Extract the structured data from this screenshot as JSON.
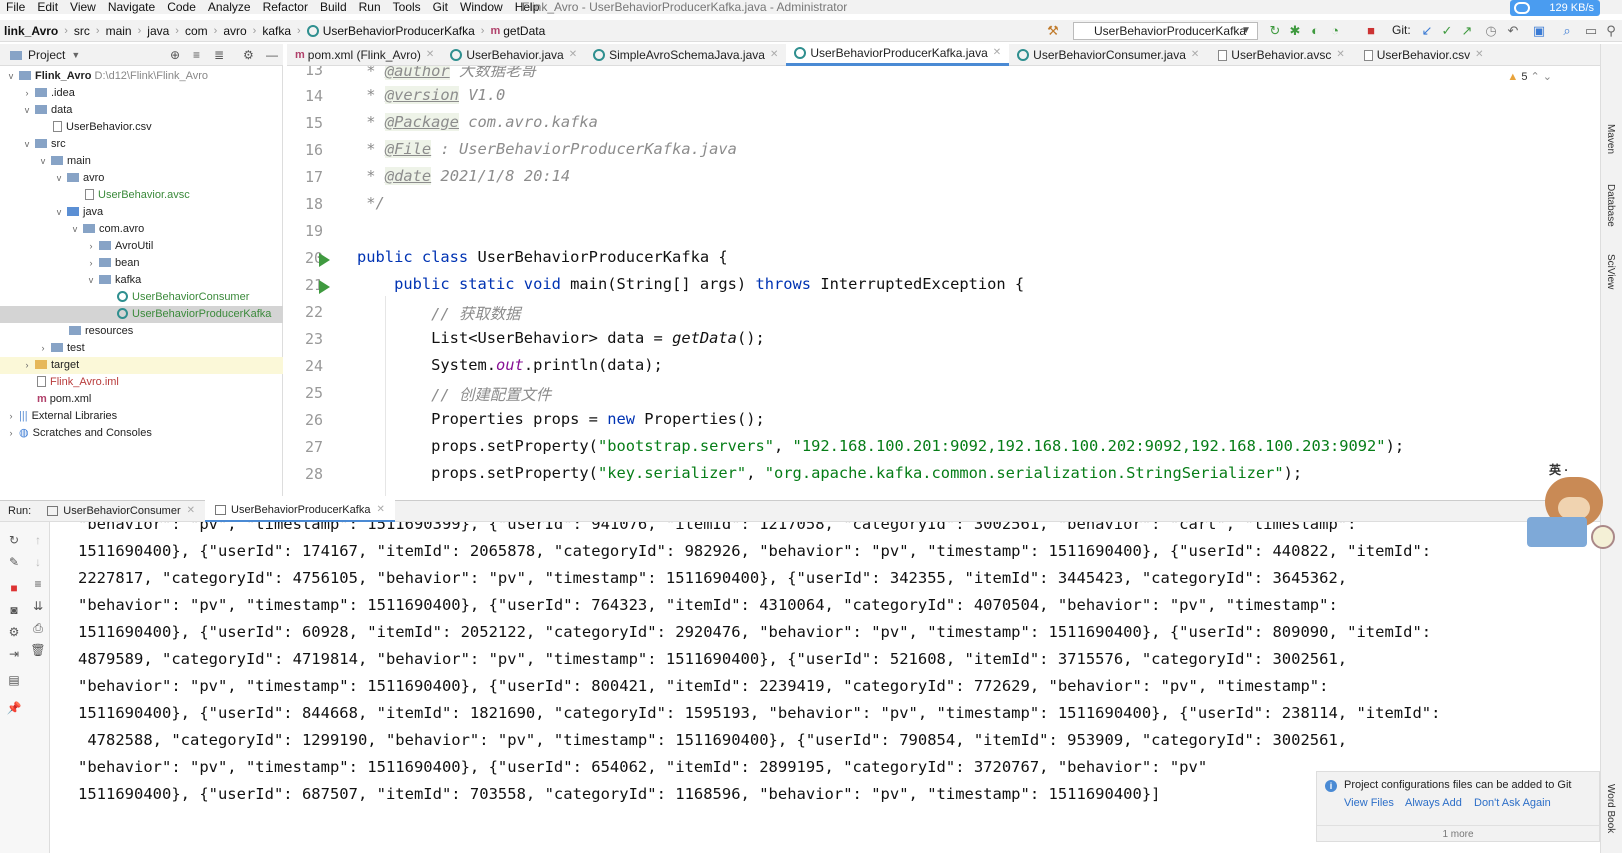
{
  "window": {
    "title": "Flink_Avro - UserBehaviorProducerKafka.java - Administrator",
    "net_speed": "129 KB/s"
  },
  "menu": [
    "File",
    "Edit",
    "View",
    "Navigate",
    "Code",
    "Analyze",
    "Refactor",
    "Build",
    "Run",
    "Tools",
    "Git",
    "Window",
    "Help"
  ],
  "breadcrumbs": [
    "link_Avro",
    "src",
    "main",
    "java",
    "com",
    "avro",
    "kafka",
    "UserBehaviorProducerKafka",
    "getData"
  ],
  "run_config": "UserBehaviorProducerKafka",
  "git_label": "Git:",
  "project_panel": {
    "title": "Project",
    "tree": [
      {
        "label": "Flink_Avro",
        "extra": "D:\\d12\\Flink\\Flink_Avro"
      },
      {
        "label": ".idea"
      },
      {
        "label": "data"
      },
      {
        "label": "UserBehavior.csv"
      },
      {
        "label": "src"
      },
      {
        "label": "main"
      },
      {
        "label": "avro"
      },
      {
        "label": "UserBehavior.avsc"
      },
      {
        "label": "java"
      },
      {
        "label": "com.avro"
      },
      {
        "label": "AvroUtil"
      },
      {
        "label": "bean"
      },
      {
        "label": "kafka"
      },
      {
        "label": "UserBehaviorConsumer"
      },
      {
        "label": "UserBehaviorProducerKafka"
      },
      {
        "label": "resources"
      },
      {
        "label": "test"
      },
      {
        "label": "target"
      },
      {
        "label": "Flink_Avro.iml"
      },
      {
        "label": "pom.xml"
      },
      {
        "label": "External Libraries"
      },
      {
        "label": "Scratches and Consoles"
      }
    ]
  },
  "editor_tabs": [
    {
      "label": "pom.xml (Flink_Avro)"
    },
    {
      "label": "UserBehavior.java"
    },
    {
      "label": "SimpleAvroSchemaJava.java"
    },
    {
      "label": "UserBehaviorProducerKafka.java"
    },
    {
      "label": "UserBehaviorConsumer.java"
    },
    {
      "label": "UserBehavior.avsc"
    },
    {
      "label": "UserBehavior.csv"
    }
  ],
  "warnings": "5",
  "code": {
    "line_numbers": [
      "13",
      "14",
      "15",
      "16",
      "17",
      "18",
      "19",
      "20",
      "21",
      "22",
      "23",
      "24",
      "25",
      "26",
      "27",
      "28"
    ],
    "l13_tag": "@author",
    "l13_rest": " 大数据老哥",
    "l14_tag": "@version",
    "l14_rest": " V1.0",
    "l15_tag": "@Package",
    "l15_rest": " com.avro.kafka",
    "l16_tag": "@File",
    "l16_rest": " : UserBehaviorProducerKafka.java",
    "l17_tag": "@date",
    "l17_rest": " 2021/1/8 20:14",
    "l18": "*/",
    "l20_kw": "public class",
    "l20_rest": " UserBehaviorProducerKafka {",
    "l21_kw": "public static void",
    "l21_mid": " main(String[] args) ",
    "l21_kw2": "throws",
    "l21_rest": " InterruptedException {",
    "l22": "// 获取数据",
    "l23_a": "List<UserBehavior> data = ",
    "l23_m": "getData",
    "l23_b": "();",
    "l24_a": "System.",
    "l24_f": "out",
    "l24_b": ".println(data);",
    "l25": "// 创建配置文件",
    "l26_a": "Properties props = ",
    "l26_kw": "new",
    "l26_b": " Properties();",
    "l27_a": "props.setProperty(",
    "l27_s1": "\"bootstrap.servers\"",
    "l27_c": ", ",
    "l27_s2": "\"192.168.100.201:9092,192.168.100.202:9092,192.168.100.203:9092\"",
    "l27_b": ");",
    "l28_a": "props.setProperty(",
    "l28_s1": "\"key.serializer\"",
    "l28_c": ", ",
    "l28_s2": "\"org.apache.kafka.common.serialization.StringSerializer\"",
    "l28_b": ");"
  },
  "run_panel": {
    "label": "Run:",
    "tabs": [
      "UserBehaviorConsumer",
      "UserBehaviorProducerKafka"
    ]
  },
  "console_lines": [
    "\"behavior\": \"pv\", \"timestamp\": 1511690399}, {\"userId\": 941076, \"itemId\": 1217058, \"categoryId\": 3002561, \"behavior\": \"cart\", \"timestamp\":",
    "1511690400}, {\"userId\": 174167, \"itemId\": 2065878, \"categoryId\": 982926, \"behavior\": \"pv\", \"timestamp\": 1511690400}, {\"userId\": 440822, \"itemId\":",
    "2227817, \"categoryId\": 4756105, \"behavior\": \"pv\", \"timestamp\": 1511690400}, {\"userId\": 342355, \"itemId\": 3445423, \"categoryId\": 3645362,",
    "\"behavior\": \"pv\", \"timestamp\": 1511690400}, {\"userId\": 764323, \"itemId\": 4310064, \"categoryId\": 4070504, \"behavior\": \"pv\", \"timestamp\":",
    "1511690400}, {\"userId\": 60928, \"itemId\": 2052122, \"categoryId\": 2920476, \"behavior\": \"pv\", \"timestamp\": 1511690400}, {\"userId\": 809090, \"itemId\":",
    "4879589, \"categoryId\": 4719814, \"behavior\": \"pv\", \"timestamp\": 1511690400}, {\"userId\": 521608, \"itemId\": 3715576, \"categoryId\": 3002561,",
    "\"behavior\": \"pv\", \"timestamp\": 1511690400}, {\"userId\": 800421, \"itemId\": 2239419, \"categoryId\": 772629, \"behavior\": \"pv\", \"timestamp\":",
    "1511690400}, {\"userId\": 844668, \"itemId\": 1821690, \"categoryId\": 1595193, \"behavior\": \"pv\", \"timestamp\": 1511690400}, {\"userId\": 238114, \"itemId\":",
    " 4782588, \"categoryId\": 1299190, \"behavior\": \"pv\", \"timestamp\": 1511690400}, {\"userId\": 790854, \"itemId\": 953909, \"categoryId\": 3002561,",
    "\"behavior\": \"pv\", \"timestamp\": 1511690400}, {\"userId\": 654062, \"itemId\": 2899195, \"categoryId\": 3720767, \"behavior\": \"pv\"",
    "1511690400}, {\"userId\": 687507, \"itemId\": 703558, \"categoryId\": 1168596, \"behavior\": \"pv\", \"timestamp\": 1511690400}]"
  ],
  "notification": {
    "message": "Project configurations files can be added to Git",
    "actions": [
      "View Files",
      "Always Add",
      "Don't Ask Again"
    ],
    "more": "1 more"
  },
  "side_labels": [
    "Maven",
    "Database",
    "SciView",
    "Word Book"
  ],
  "mascot_text": "英 ·"
}
